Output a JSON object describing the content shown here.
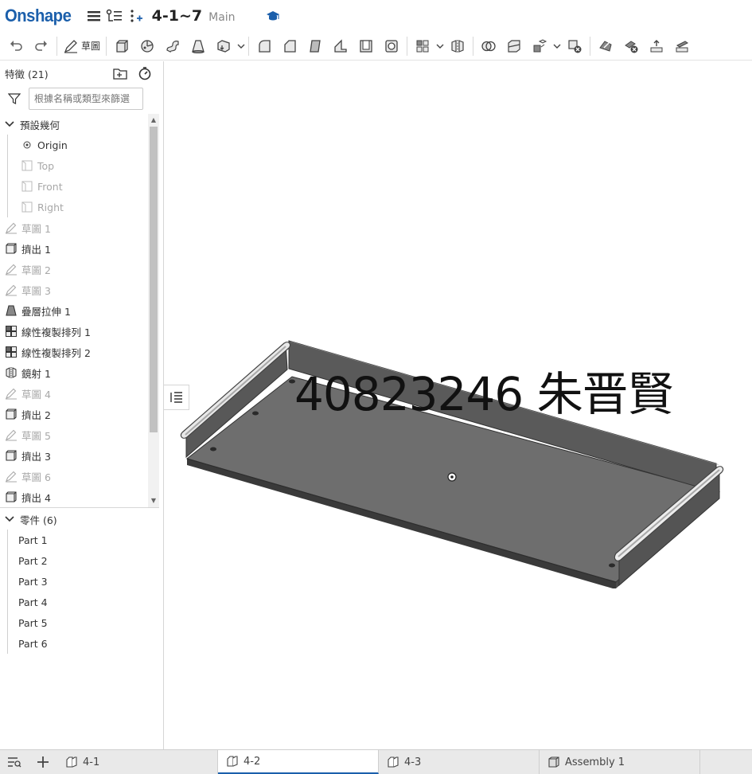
{
  "app": {
    "logo": "Onshape",
    "doc_title": "4-1~7",
    "branch": "Main"
  },
  "toolbar": {
    "sketch_label": "草圖"
  },
  "features": {
    "header": "特徵 (21)",
    "filter_placeholder": "根據名稱或類型來篩選",
    "group_label": "預設幾何",
    "origin": "Origin",
    "planes": [
      "Top",
      "Front",
      "Right"
    ],
    "items": [
      {
        "label": "草圖 1",
        "icon": "sketch-icon",
        "dim": true
      },
      {
        "label": "擠出 1",
        "icon": "extrude-icon",
        "dim": false
      },
      {
        "label": "草圖 2",
        "icon": "sketch-icon",
        "dim": true
      },
      {
        "label": "草圖 3",
        "icon": "sketch-icon",
        "dim": true
      },
      {
        "label": "疊層拉伸 1",
        "icon": "loft-icon",
        "dim": false
      },
      {
        "label": "線性複製排列 1",
        "icon": "linear-pattern-icon",
        "dim": false
      },
      {
        "label": "線性複製排列 2",
        "icon": "linear-pattern-icon",
        "dim": false
      },
      {
        "label": "鏡射 1",
        "icon": "mirror-icon",
        "dim": false
      },
      {
        "label": "草圖 4",
        "icon": "sketch-icon",
        "dim": true
      },
      {
        "label": "擠出 2",
        "icon": "extrude-icon",
        "dim": false
      },
      {
        "label": "草圖 5",
        "icon": "sketch-icon",
        "dim": true
      },
      {
        "label": "擠出 3",
        "icon": "extrude-icon",
        "dim": false
      },
      {
        "label": "草圖 6",
        "icon": "sketch-icon",
        "dim": true
      },
      {
        "label": "擠出 4",
        "icon": "extrude-icon",
        "dim": false
      }
    ]
  },
  "parts": {
    "header": "零件 (6)",
    "items": [
      "Part 1",
      "Part 2",
      "Part 3",
      "Part 4",
      "Part 5",
      "Part 6"
    ]
  },
  "viewport": {
    "watermark": "40823246 朱晋賢"
  },
  "tabs": [
    {
      "label": "4-1",
      "active": false
    },
    {
      "label": "4-2",
      "active": true
    },
    {
      "label": "4-3",
      "active": false
    },
    {
      "label": "Assembly 1",
      "active": false
    }
  ],
  "colors": {
    "brand": "#1b5fab",
    "model_face": "#6f6f6f",
    "model_dark": "#4a4a4a"
  }
}
